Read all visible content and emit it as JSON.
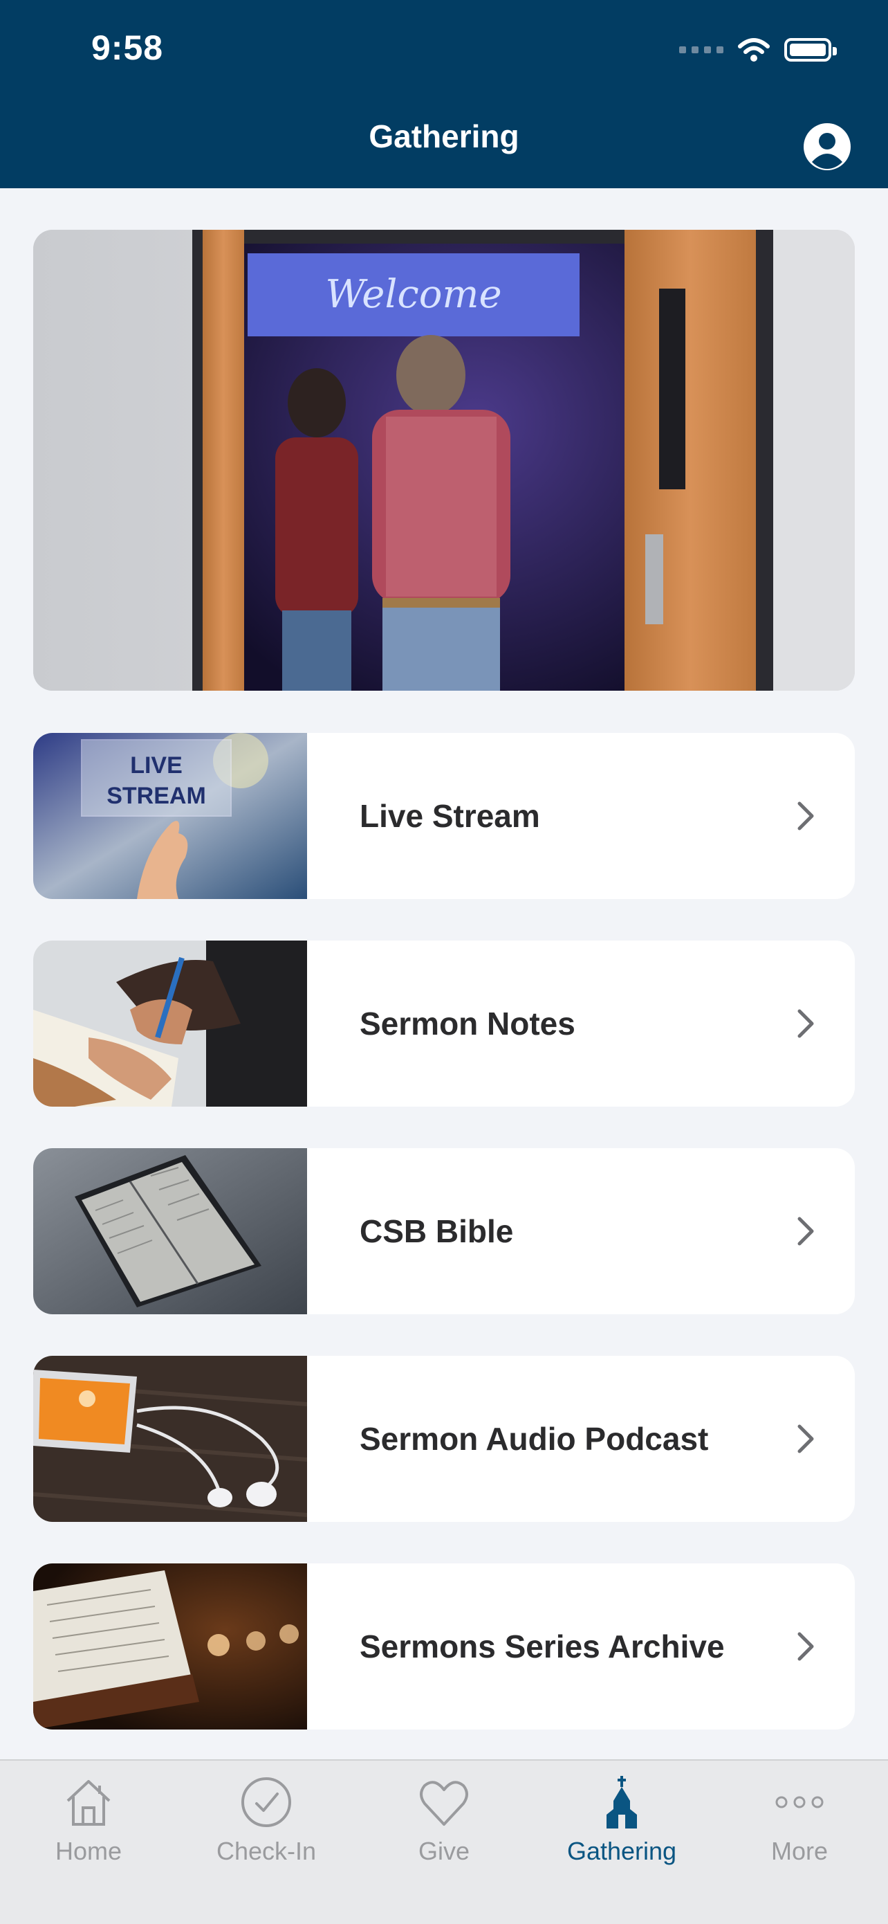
{
  "status_bar": {
    "time": "9:58"
  },
  "header": {
    "title": "Gathering"
  },
  "hero": {
    "banner_text": "Welcome"
  },
  "items": [
    {
      "label": "Live Stream",
      "thumb_text": "LIVE\nSTREAM",
      "thumb_line1": "LIVE",
      "thumb_line2": "STREAM"
    },
    {
      "label": "Sermon Notes"
    },
    {
      "label": "CSB Bible"
    },
    {
      "label": "Sermon Audio Podcast"
    },
    {
      "label": "Sermons Series Archive"
    }
  ],
  "tabbar": {
    "tabs": [
      {
        "label": "Home",
        "icon": "home-icon"
      },
      {
        "label": "Check-In",
        "icon": "check-circle-icon"
      },
      {
        "label": "Give",
        "icon": "heart-icon"
      },
      {
        "label": "Gathering",
        "icon": "church-icon",
        "active": true
      },
      {
        "label": "More",
        "icon": "more-dots-icon"
      }
    ]
  },
  "colors": {
    "header": "#023d63",
    "active_tab": "#0a5582",
    "inactive_tab": "#9a9b9e",
    "background": "#f2f4f8"
  }
}
